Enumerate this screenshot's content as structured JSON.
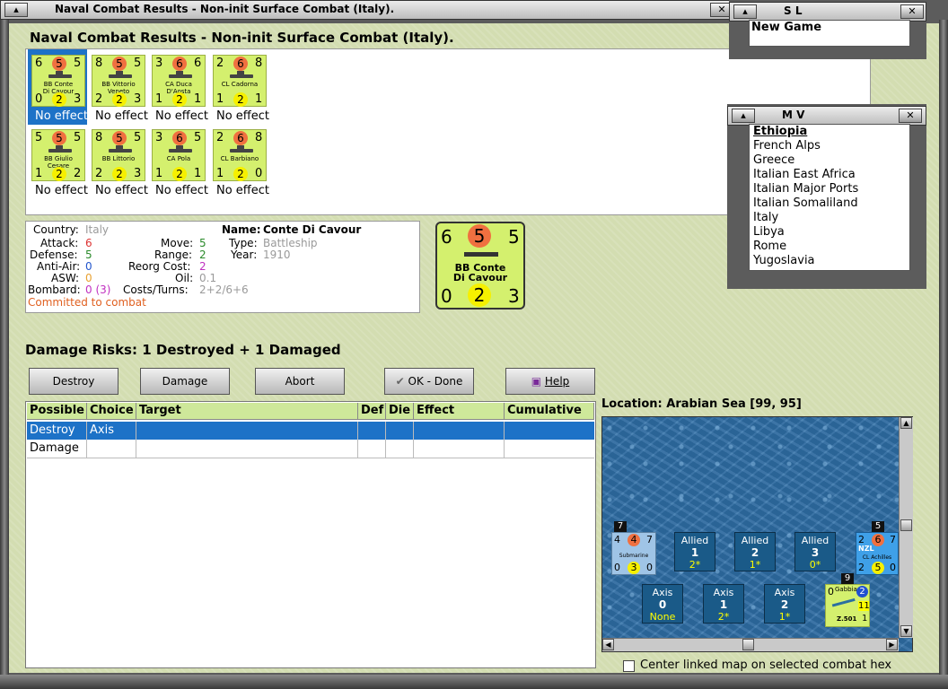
{
  "window": {
    "title": "Naval Combat Results - Non-init Surface Combat (Italy)."
  },
  "heading": "Naval Combat Results - Non-init Surface Combat (Italy).",
  "units": [
    {
      "tl": "6",
      "att": "5",
      "tr": "5",
      "name": "BB Conte\nDi Cavour",
      "bl": "0",
      "def": "2",
      "br": "3",
      "effect": "No effect",
      "selected": true
    },
    {
      "tl": "8",
      "att": "5",
      "tr": "5",
      "name": "BB Vittorio\nVeneto",
      "bl": "2",
      "def": "2",
      "br": "3",
      "effect": "No effect"
    },
    {
      "tl": "3",
      "att": "6",
      "tr": "6",
      "name": "CA Duca D'Aosta",
      "bl": "1",
      "def": "2",
      "br": "1",
      "effect": "No effect"
    },
    {
      "tl": "2",
      "att": "6",
      "tr": "8",
      "name": "CL Cadorna",
      "bl": "1",
      "def": "2",
      "br": "1",
      "effect": "No effect"
    },
    {
      "tl": "5",
      "att": "5",
      "tr": "5",
      "name": "BB Giulio Cesare",
      "bl": "1",
      "def": "2",
      "br": "2",
      "effect": "No effect"
    },
    {
      "tl": "8",
      "att": "5",
      "tr": "5",
      "name": "BB Littorio",
      "bl": "2",
      "def": "2",
      "br": "3",
      "effect": "No effect"
    },
    {
      "tl": "3",
      "att": "6",
      "tr": "5",
      "name": "CA Pola",
      "bl": "1",
      "def": "2",
      "br": "1",
      "effect": "No effect"
    },
    {
      "tl": "2",
      "att": "6",
      "tr": "8",
      "name": "CL Barbiano",
      "bl": "1",
      "def": "2",
      "br": "0",
      "effect": "No effect"
    }
  ],
  "info": {
    "country_label": "Country:",
    "country": "Italy",
    "attack_label": "Attack:",
    "attack": "6",
    "defense_label": "Defense:",
    "defense": "5",
    "antiair_label": "Anti-Air:",
    "antiair": "0",
    "asw_label": "ASW:",
    "asw": "0",
    "bombard_label": "Bombard:",
    "bombard": "0 (3)",
    "committed": "Committed to combat",
    "move_label": "Move:",
    "move": "5",
    "range_label": "Range:",
    "range": "2",
    "reorg_label": "Reorg Cost:",
    "reorg": "2",
    "oil_label": "Oil:",
    "oil": "0.1",
    "costs_label": "Costs/Turns:",
    "costs": "2+2/6+6",
    "name_label": "Name:",
    "name": "Conte Di Cavour",
    "type_label": "Type:",
    "type": "Battleship",
    "year_label": "Year:",
    "year": "1910"
  },
  "big_counter": {
    "tl": "6",
    "att": "5",
    "tr": "5",
    "name": "BB Conte\nDi Cavour",
    "bl": "0",
    "def": "2",
    "br": "3"
  },
  "damage_risks": "Damage Risks:  1 Destroyed + 1 Damaged",
  "buttons": {
    "destroy": "Destroy",
    "damage": "Damage",
    "abort": "Abort",
    "ok": "OK - Done",
    "help": "Help"
  },
  "table": {
    "headers": [
      "Possible",
      "Choice",
      "Target",
      "Def",
      "Die",
      "Effect",
      "Cumulative"
    ],
    "rows": [
      [
        "Destroy",
        "Axis",
        "",
        "",
        "",
        "",
        ""
      ],
      [
        "Damage",
        "",
        "",
        "",
        "",
        "",
        ""
      ]
    ]
  },
  "location": "Location:  Arabian Sea [99, 95]",
  "map": {
    "allied_slots": [
      {
        "l1": "Allied",
        "l2": "1",
        "l3": "2*"
      },
      {
        "l1": "Allied",
        "l2": "2",
        "l3": "1*"
      },
      {
        "l1": "Allied",
        "l2": "3",
        "l3": "0*"
      }
    ],
    "axis_slots": [
      {
        "l1": "Axis",
        "l2": "0",
        "l3": "None"
      },
      {
        "l1": "Axis",
        "l2": "1",
        "l3": "2*"
      },
      {
        "l1": "Axis",
        "l2": "2",
        "l3": "1*"
      }
    ],
    "sub": {
      "badge": "7",
      "tl": "4",
      "att": "4",
      "tr": "7",
      "name": "Submarine",
      "bl": "0",
      "def": "3",
      "br": "0"
    },
    "allied_cl": {
      "badge": "5",
      "tl": "2",
      "att": "6",
      "tr": "7",
      "name": "CL Achilles",
      "nat": "NZL",
      "bl": "2",
      "def": "5",
      "br": "0"
    },
    "axis_air": {
      "badge": "9",
      "tl": "0",
      "name": "Gabbiano",
      "model": "Z.501",
      "def": "2",
      "br": "11",
      "br2": "1"
    }
  },
  "center_link": "Center linked map on selected combat hex",
  "sl_panel": {
    "title": "S L",
    "item": "New Game"
  },
  "mv_panel": {
    "title": "M V",
    "items": [
      "Ethiopia",
      "French Alps",
      "Greece",
      "Italian East Africa",
      "Italian Major Ports",
      "Italian Somaliland",
      "Italy",
      "Libya",
      "Rome",
      "Yugoslavia"
    ]
  }
}
